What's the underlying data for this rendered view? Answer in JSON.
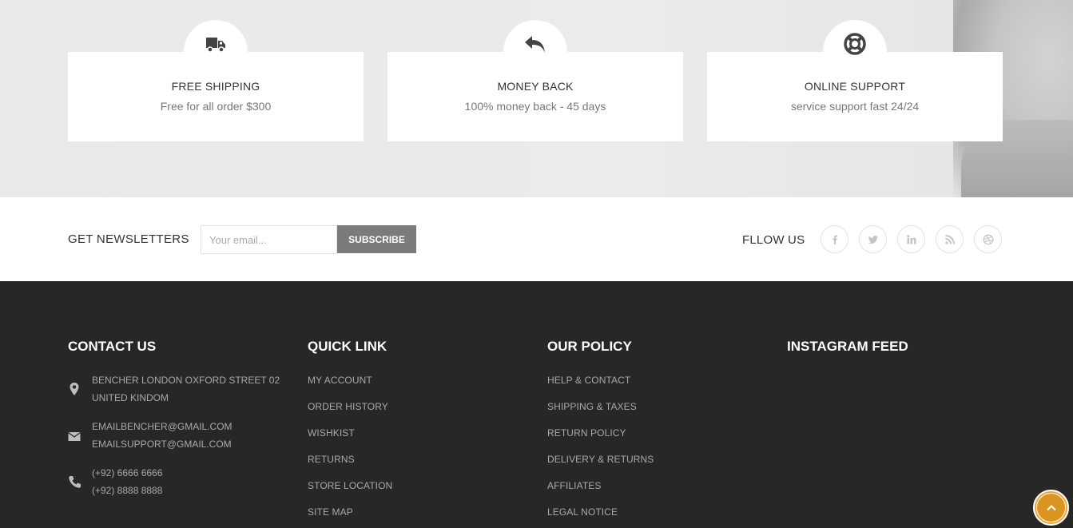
{
  "services": [
    {
      "title": "FREE SHIPPING",
      "subtitle": "Free for all order $300",
      "icon": "truck-icon"
    },
    {
      "title": "MONEY BACK",
      "subtitle": "100% money back - 45 days",
      "icon": "reply-arrow-icon"
    },
    {
      "title": "ONLINE SUPPORT",
      "subtitle": "service support fast 24/24",
      "icon": "lifebuoy-icon"
    }
  ],
  "newsletter": {
    "title": "GET NEWSLETTERS",
    "placeholder": "Your email...",
    "button": "SUBSCRIBE"
  },
  "follow": {
    "title": "FLLOW US",
    "icons": [
      "facebook-icon",
      "twitter-icon",
      "linkedin-icon",
      "rss-icon",
      "dribbble-icon"
    ]
  },
  "footer": {
    "contact": {
      "title": "CONTACT US",
      "address": [
        "BENCHER LONDON OXFORD STREET 02",
        "UNITED KINDOM"
      ],
      "emails": [
        "EMAILBENCHER@GMAIL.COM",
        "EMAILSUPPORT@GMAIL.COM"
      ],
      "phones": [
        "(+92) 6666 6666",
        "(+92) 8888 8888"
      ]
    },
    "quick_link": {
      "title": "QUICK LINK",
      "items": [
        "MY ACCOUNT",
        "ORDER HISTORY",
        "WISHKIST",
        "RETURNS",
        "STORE LOCATION",
        "SITE MAP"
      ]
    },
    "policy": {
      "title": "OUR POLICY",
      "items": [
        "HELP & CONTACT",
        "SHIPPING & TAXES",
        "RETURN POLICY",
        "DELIVERY & RETURNS",
        "AFFILIATES",
        "LEGAL NOTICE"
      ]
    },
    "instagram": {
      "title": "INSTAGRAM FEED"
    }
  },
  "colors": {
    "footer_bg": "#272727",
    "accent": "#e9a53b",
    "button_bg": "#7b7b7b"
  }
}
